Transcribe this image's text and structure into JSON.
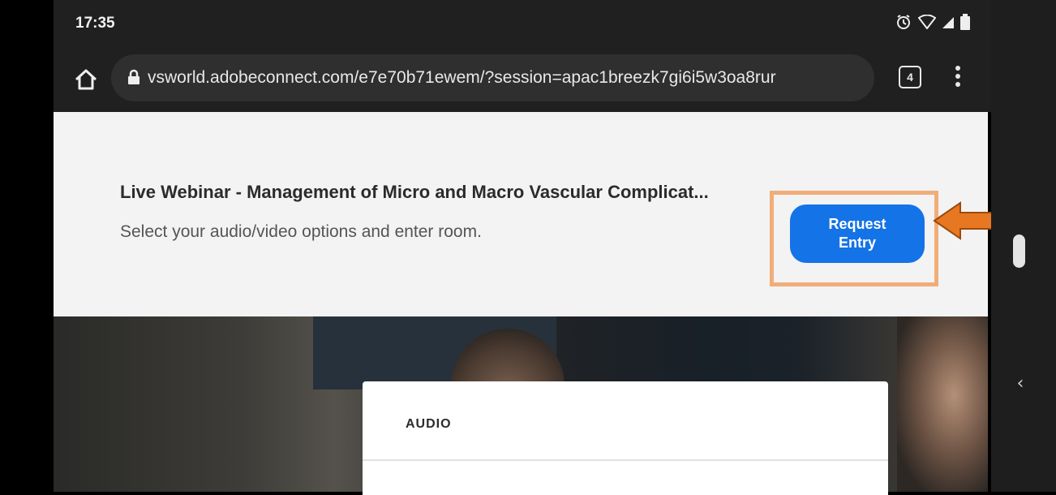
{
  "status_bar": {
    "time": "17:35",
    "icons": [
      "alarm-icon",
      "wifi-icon",
      "signal-icon",
      "battery-icon"
    ]
  },
  "browser": {
    "url": "vsworld.adobeconnect.com/e7e70b71ewem/?session=apac1breezk7gi6i5w3oa8rur",
    "tab_count": "4",
    "icons": [
      "home-icon",
      "lock-icon",
      "tabs-icon",
      "more-options-icon"
    ]
  },
  "banner": {
    "title": "Live Webinar - Management of Micro and Macro Vascular Complicat...",
    "subtitle": "Select your audio/video options and enter room.",
    "request_button_label": "Request\nEntry"
  },
  "audio_card": {
    "label": "AUDIO"
  },
  "colors": {
    "accent": "#1473e6",
    "highlight": "#f1ad79",
    "arrow": "#e87722",
    "browser_chrome": "#202020"
  }
}
